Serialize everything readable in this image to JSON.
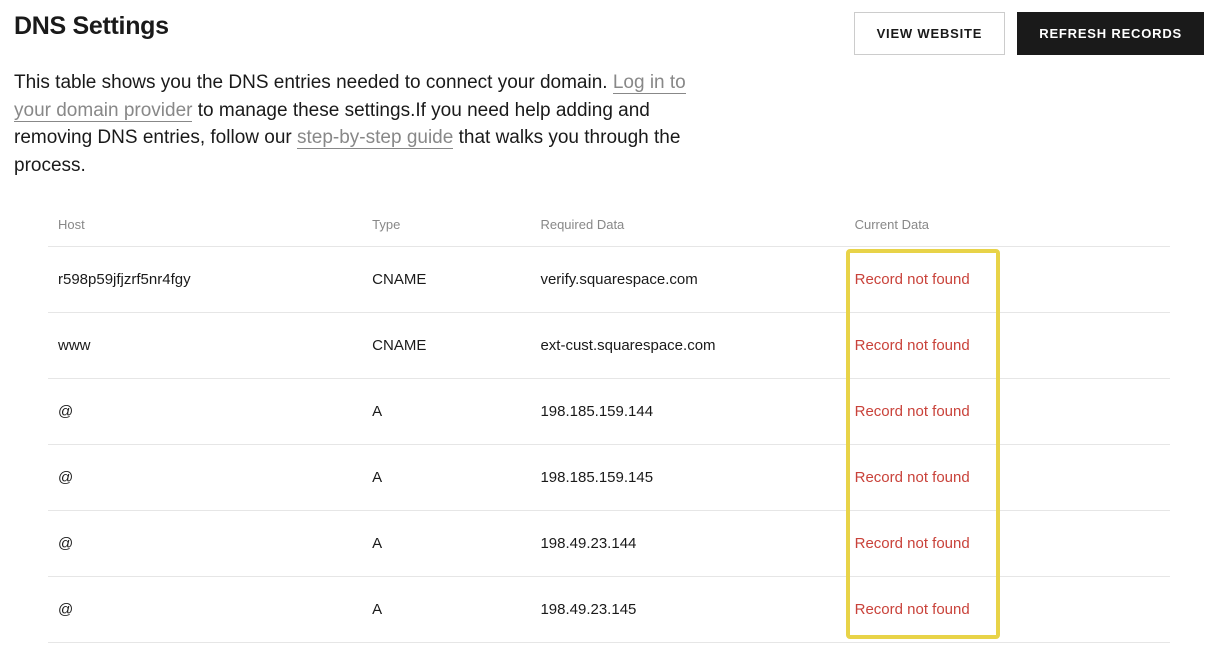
{
  "page_title": "DNS Settings",
  "buttons": {
    "view_website": "VIEW WEBSITE",
    "refresh_records": "REFRESH RECORDS"
  },
  "description": {
    "part1": "This table shows you the DNS entries needed to connect your domain. ",
    "link1": "Log in to your domain provider",
    "part2": " to manage these settings.If you need help adding and removing DNS entries, follow our ",
    "link2": "step-by-step guide",
    "part3": " that walks you through the process."
  },
  "table": {
    "headers": {
      "host": "Host",
      "type": "Type",
      "required_data": "Required Data",
      "current_data": "Current Data"
    },
    "rows": [
      {
        "host": "r598p59jfjzrf5nr4fgy",
        "type": "CNAME",
        "required_data": "verify.squarespace.com",
        "current_data": "Record not found"
      },
      {
        "host": "www",
        "type": "CNAME",
        "required_data": "ext-cust.squarespace.com",
        "current_data": "Record not found"
      },
      {
        "host": "@",
        "type": "A",
        "required_data": "198.185.159.144",
        "current_data": "Record not found"
      },
      {
        "host": "@",
        "type": "A",
        "required_data": "198.185.159.145",
        "current_data": "Record not found"
      },
      {
        "host": "@",
        "type": "A",
        "required_data": "198.49.23.144",
        "current_data": "Record not found"
      },
      {
        "host": "@",
        "type": "A",
        "required_data": "198.49.23.145",
        "current_data": "Record not found"
      }
    ]
  }
}
